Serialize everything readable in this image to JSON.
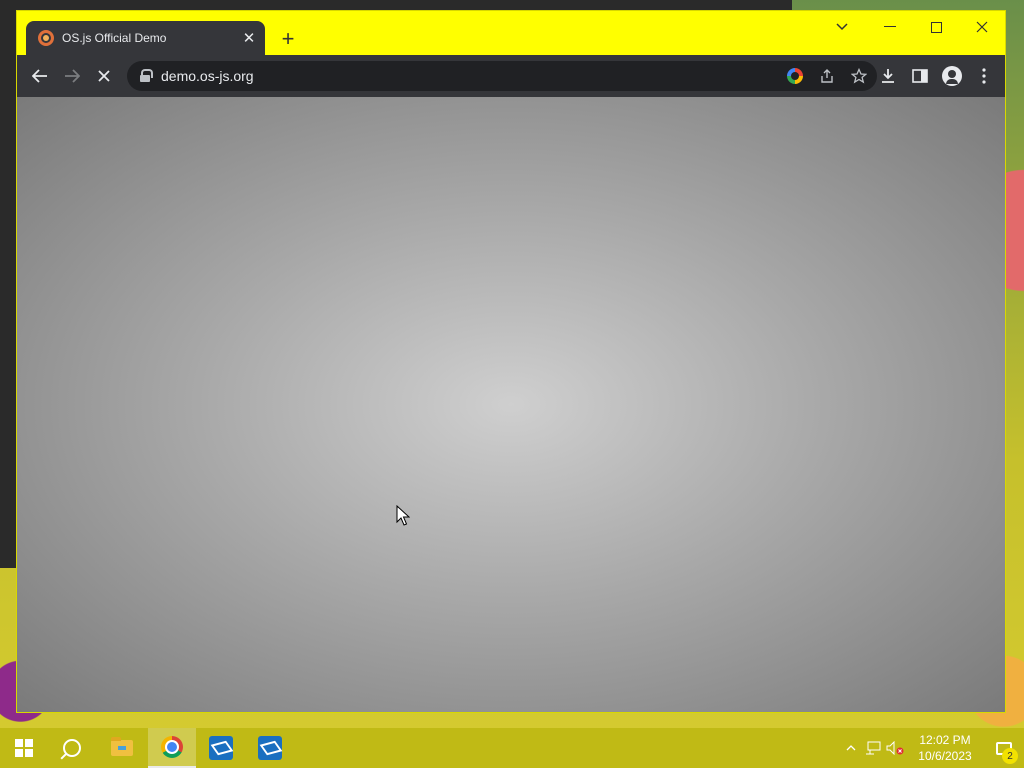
{
  "browser": {
    "tab": {
      "title": "OS.js Official Demo",
      "close_icon": "close-icon",
      "favicon": "osjs-favicon"
    },
    "new_tab_icon": "plus-icon",
    "window_controls": {
      "tab_search": "chevron-down-icon",
      "minimize": "minimize-icon",
      "maximize": "maximize-icon",
      "close": "close-icon"
    },
    "toolbar": {
      "back_icon": "back-arrow-icon",
      "forward_icon": "forward-arrow-icon",
      "stop_icon": "stop-loading-icon",
      "url": "demo.os-js.org",
      "omnibox_icons": [
        "google-icon",
        "share-icon",
        "bookmark-star-icon"
      ],
      "right_icons": [
        "download-icon",
        "side-panel-icon",
        "profile-icon",
        "menu-icon"
      ]
    },
    "tabbar_color": "#ffff00",
    "toolbar_color": "#35363a"
  },
  "taskbar": {
    "apps": [
      {
        "name": "start-button",
        "icon": "windows-logo-icon"
      },
      {
        "name": "search",
        "icon": "search-icon"
      },
      {
        "name": "file-explorer",
        "icon": "folder-icon"
      },
      {
        "name": "chrome",
        "icon": "chrome-icon",
        "active": true
      },
      {
        "name": "app-1",
        "icon": "virtualbox-icon"
      },
      {
        "name": "app-2",
        "icon": "virtualbox-icon"
      }
    ],
    "tray": {
      "time": "12:02 PM",
      "date": "10/6/2023",
      "notification_count": "2",
      "icons": [
        "chevron-up-icon",
        "network-icon",
        "volume-muted-icon"
      ]
    },
    "color": "#c6c014"
  }
}
